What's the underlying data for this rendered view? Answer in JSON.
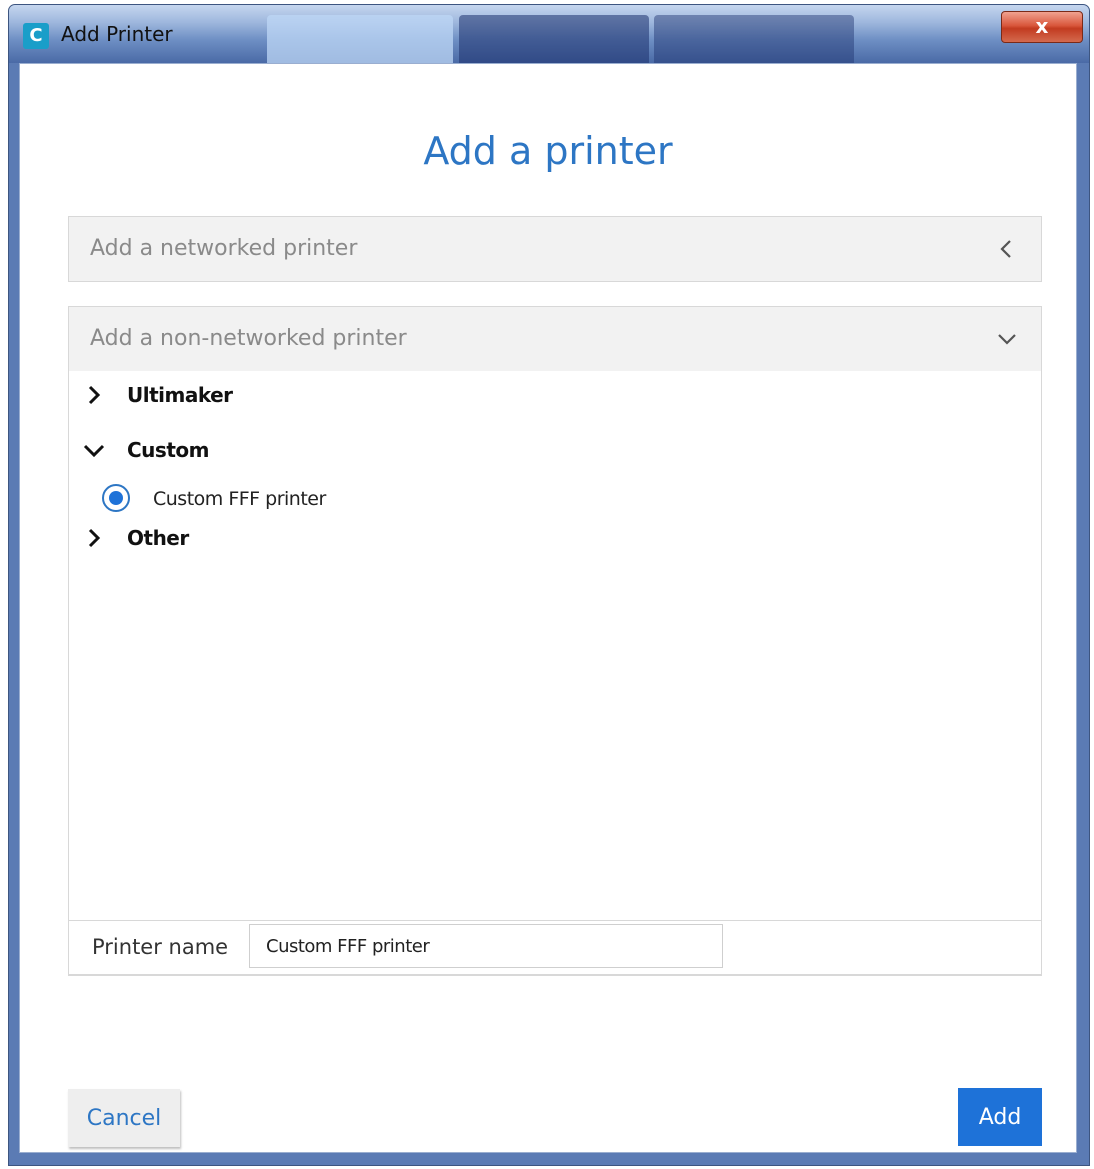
{
  "window": {
    "title": "Add Printer",
    "app_icon_letter": "C",
    "close_symbol": "x"
  },
  "heading": "Add a printer",
  "sections": {
    "networked": {
      "label": "Add a networked printer",
      "icon": "chevron-left-icon",
      "expanded": false
    },
    "non_networked": {
      "label": "Add a non-networked printer",
      "icon": "chevron-down-icon",
      "expanded": true
    }
  },
  "tree": {
    "ultimaker": {
      "label": "Ultimaker",
      "expanded": false
    },
    "custom": {
      "label": "Custom",
      "expanded": true
    },
    "custom_fff": {
      "label": "Custom FFF printer",
      "selected": true
    },
    "other": {
      "label": "Other",
      "expanded": false
    }
  },
  "printer_name": {
    "label": "Printer name",
    "value": "Custom FFF printer"
  },
  "buttons": {
    "cancel": "Cancel",
    "add": "Add"
  },
  "colors": {
    "accent": "#2d76c4",
    "primary_button": "#1e72d8",
    "close_button": "#c23b20"
  }
}
